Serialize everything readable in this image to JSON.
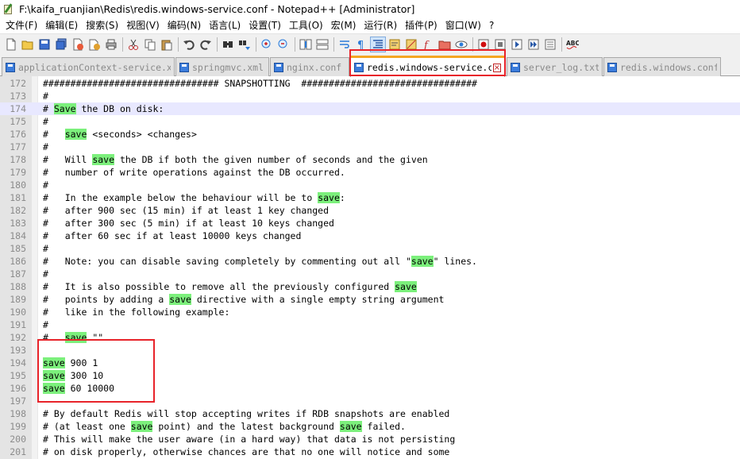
{
  "window": {
    "title": "F:\\kaifa_ruanjian\\Redis\\redis.windows-service.conf - Notepad++ [Administrator]"
  },
  "menu": [
    "文件(F)",
    "编辑(E)",
    "搜索(S)",
    "视图(V)",
    "编码(N)",
    "语言(L)",
    "设置(T)",
    "工具(O)",
    "宏(M)",
    "运行(R)",
    "插件(P)",
    "窗口(W)",
    "?"
  ],
  "toolbar": {
    "buttons": [
      "new-file-icon",
      "open-file-icon",
      "save-icon",
      "save-all-icon",
      "close-icon",
      "close-all-icon",
      "print-icon",
      "cut-icon",
      "copy-icon",
      "paste-icon",
      "undo-icon",
      "redo-icon",
      "find-icon",
      "replace-icon",
      "zoom-in-icon",
      "zoom-out-icon",
      "sync-vertical-icon",
      "sync-horizontal-icon",
      "word-wrap-icon",
      "show-all-chars-icon",
      "indent-guide-icon",
      "udl-icon",
      "doc-map-icon",
      "function-list-icon",
      "folder-workspace-icon",
      "monitor-icon",
      "record-macro-icon",
      "stop-macro-icon",
      "play-macro-icon",
      "run-macro-multiple-icon",
      "save-macro-icon",
      "spell-check-icon"
    ],
    "spellcheck_label": "ABC"
  },
  "tabs": [
    {
      "label": "applicationContext-service.xml",
      "active": false
    },
    {
      "label": "springmvc.xml",
      "active": false
    },
    {
      "label": "nginx.conf",
      "active": false
    },
    {
      "label": "redis.windows-service.conf",
      "active": true
    },
    {
      "label": "server_log.txt",
      "active": false
    },
    {
      "label": "redis.windows.conf",
      "active": false
    }
  ],
  "editor": {
    "lines": [
      {
        "n": "172",
        "text": "################################ SNAPSHOTTING  ################################"
      },
      {
        "n": "173",
        "text": "#"
      },
      {
        "n": "174",
        "text": "# Save the DB on disk:",
        "current": true
      },
      {
        "n": "175",
        "text": "#"
      },
      {
        "n": "176",
        "text": "#   save <seconds> <changes>"
      },
      {
        "n": "177",
        "text": "#"
      },
      {
        "n": "178",
        "text": "#   Will save the DB if both the given number of seconds and the given"
      },
      {
        "n": "179",
        "text": "#   number of write operations against the DB occurred."
      },
      {
        "n": "180",
        "text": "#"
      },
      {
        "n": "181",
        "text": "#   In the example below the behaviour will be to save:"
      },
      {
        "n": "182",
        "text": "#   after 900 sec (15 min) if at least 1 key changed"
      },
      {
        "n": "183",
        "text": "#   after 300 sec (5 min) if at least 10 keys changed"
      },
      {
        "n": "184",
        "text": "#   after 60 sec if at least 10000 keys changed"
      },
      {
        "n": "185",
        "text": "#"
      },
      {
        "n": "186",
        "text": "#   Note: you can disable saving completely by commenting out all \"save\" lines."
      },
      {
        "n": "187",
        "text": "#"
      },
      {
        "n": "188",
        "text": "#   It is also possible to remove all the previously configured save"
      },
      {
        "n": "189",
        "text": "#   points by adding a save directive with a single empty string argument"
      },
      {
        "n": "190",
        "text": "#   like in the following example:"
      },
      {
        "n": "191",
        "text": "#"
      },
      {
        "n": "192",
        "text": "#   save \"\""
      },
      {
        "n": "193",
        "text": ""
      },
      {
        "n": "194",
        "text": "save 900 1"
      },
      {
        "n": "195",
        "text": "save 300 10"
      },
      {
        "n": "196",
        "text": "save 60 10000"
      },
      {
        "n": "197",
        "text": ""
      },
      {
        "n": "198",
        "text": "# By default Redis will stop accepting writes if RDB snapshots are enabled"
      },
      {
        "n": "199",
        "text": "# (at least one save point) and the latest background save failed."
      },
      {
        "n": "200",
        "text": "# This will make the user aware (in a hard way) that data is not persisting"
      },
      {
        "n": "201",
        "text": "# on disk properly, otherwise chances are that no one will notice and some"
      }
    ],
    "search_term": "save",
    "highlight_color": "#7cf07c"
  },
  "colors": {
    "annotation_red": "#e8232a",
    "active_tab_accent": "#f5a623"
  }
}
